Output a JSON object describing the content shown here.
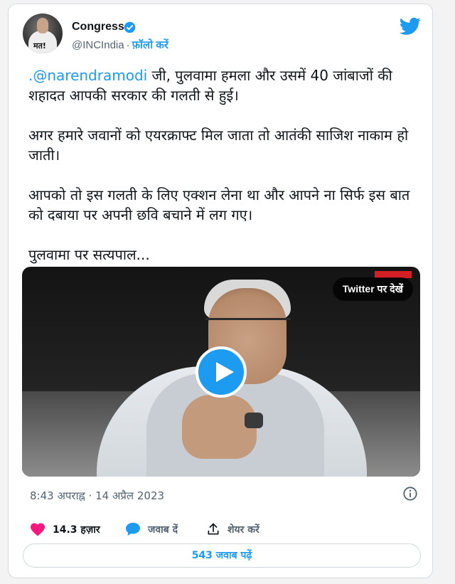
{
  "author": {
    "name": "Congress",
    "handle": "@INCIndia",
    "separator": "·",
    "follow_label": "फ़ॉलो करें",
    "avatar_text": "मत!"
  },
  "tweet": {
    "mention": ".@narendramodi",
    "para1_rest": " जी, पुलवामा हमला और उसमें 40 जांबाजों की शहादत आपकी सरकार की गलती से हुई।",
    "para2": "अगर हमारे जवानों को एयरक्राफ्ट मिल जाता तो आतंकी साजिश नाकाम हो जाती।",
    "para3": "आपको तो इस गलती के लिए एक्शन लेना था और आपने ना सिर्फ इस बात को दबाया पर अपनी छवि बचाने में लग गए।",
    "para4": "पुलवामा पर सत्यपाल..."
  },
  "video": {
    "watch_on_twitter": "Twitter पर देखें"
  },
  "timestamp": "8:43 अपराह्न · 14 अप्रैल 2023",
  "actions": {
    "likes": "14.3 हज़ार",
    "reply": "जवाब दें",
    "share": "शेयर करें"
  },
  "read_replies": "543 जवाब पढ़ें",
  "colors": {
    "accent": "#1d9bf0",
    "like": "#f91880",
    "text": "#0f1419",
    "muted": "#536471"
  }
}
